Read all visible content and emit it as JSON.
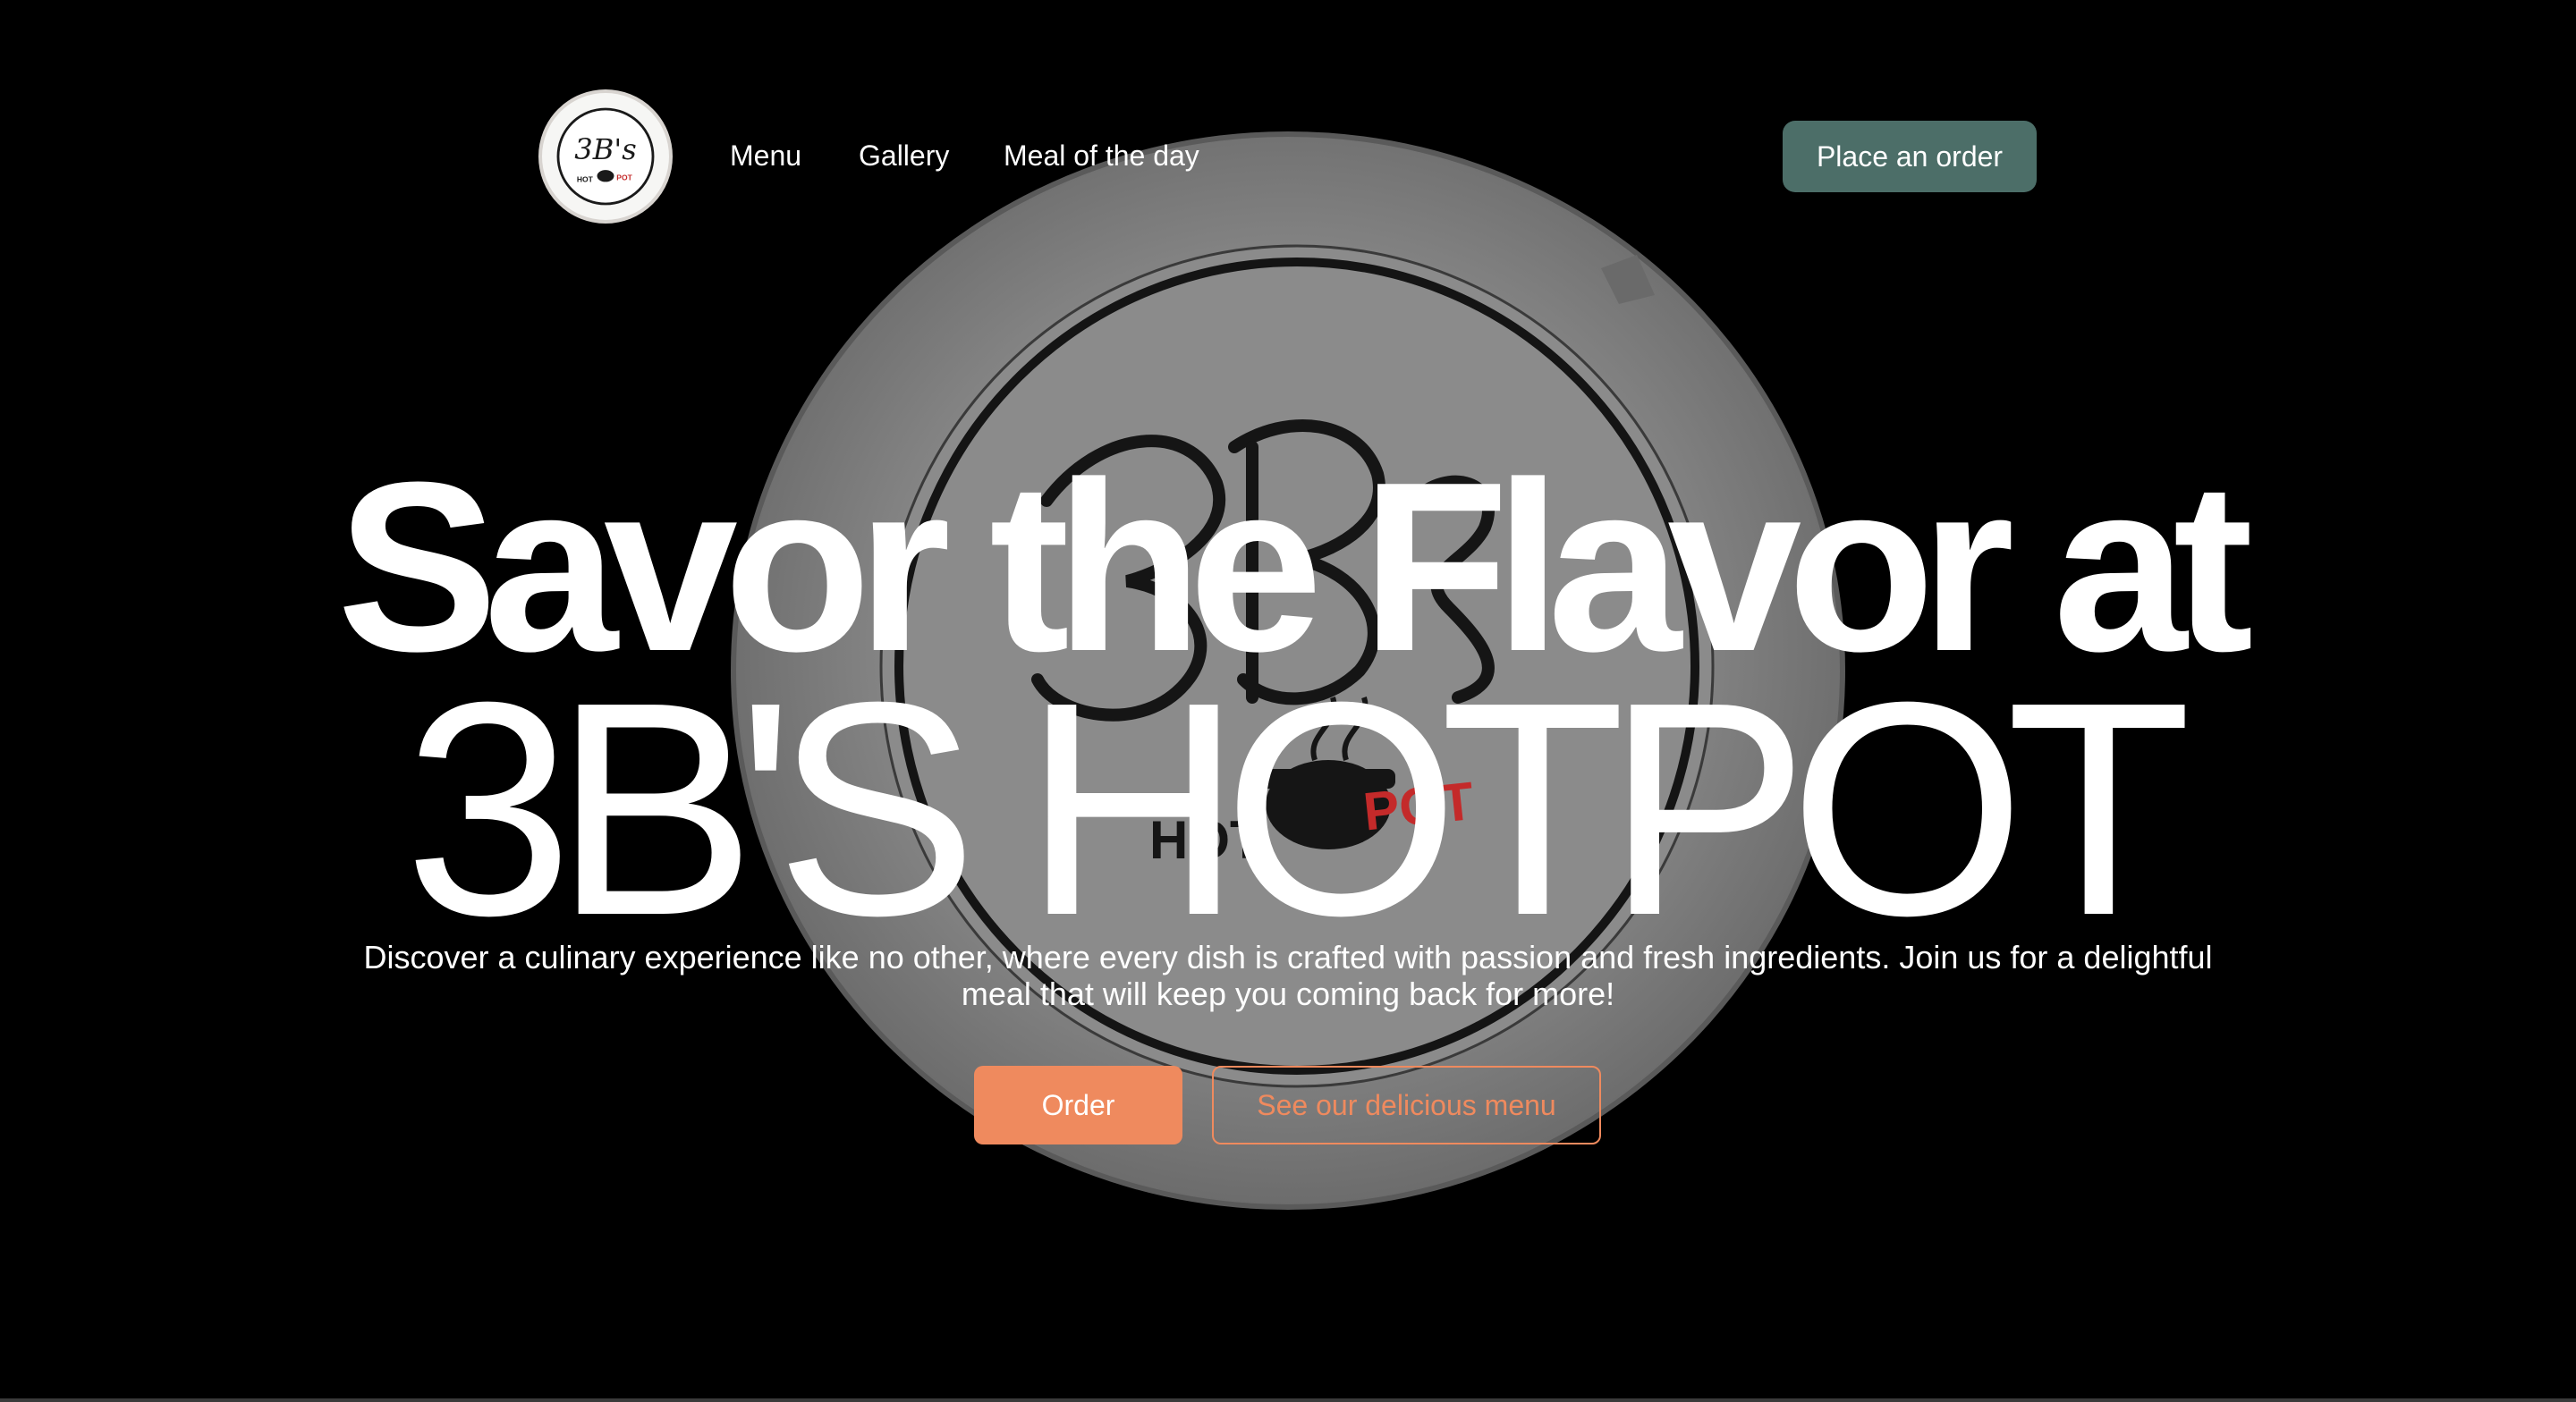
{
  "brand": {
    "logo_text": "3B's",
    "logo_sub_left": "HOT",
    "logo_sub_right": "POT"
  },
  "nav": {
    "items": [
      {
        "label": "Menu"
      },
      {
        "label": "Gallery"
      },
      {
        "label": "Meal of the day"
      }
    ],
    "cta_label": "Place an order"
  },
  "hero": {
    "title_line1": "Savor the Flavor at",
    "title_line2": "3B'S HOTPOT",
    "description": "Discover a culinary experience like no other, where every dish is crafted with passion and fresh ingredients. Join us for a delightful meal that will keep you coming back for more!",
    "primary_button": "Order",
    "secondary_button": "See our delicious menu"
  },
  "colors": {
    "background": "#000000",
    "nav_cta": "#4c6e68",
    "accent": "#ef8a5e",
    "text": "#ffffff",
    "plate": "#8a8a8a",
    "logo_red": "#c42a2a"
  }
}
